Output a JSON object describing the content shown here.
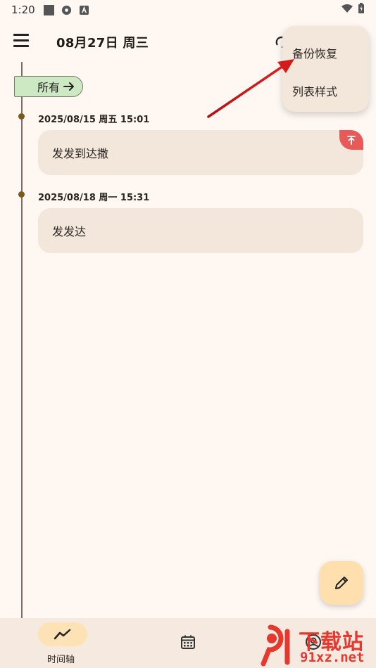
{
  "status_bar": {
    "time": "1:20"
  },
  "app_bar": {
    "title": "08月27日 周三"
  },
  "filter_chip": {
    "label": "所有"
  },
  "entries": [
    {
      "timestamp": "2025/08/15 周五 15:01",
      "text": "发发到达撒",
      "pinned": true
    },
    {
      "timestamp": "2025/08/18 周一 15:31",
      "text": "发发达",
      "pinned": false
    }
  ],
  "popup_menu": {
    "items": [
      {
        "label": "备份恢复"
      },
      {
        "label": "列表样式"
      }
    ]
  },
  "bottom_nav": {
    "items": [
      {
        "label": "时间轴",
        "icon": "timeline-icon",
        "active": true
      },
      {
        "label": "",
        "icon": "calendar-icon",
        "active": false
      },
      {
        "label": "",
        "icon": "profile-icon",
        "active": false
      }
    ]
  },
  "watermark": {
    "text_big": "下载站",
    "text_small": "91xz.net"
  },
  "colors": {
    "background": "#fff7f2",
    "card": "#f3e6db",
    "chip": "#cde9c3",
    "fab": "#ffdfad",
    "pin_badge": "#e85a5a",
    "accent_red": "#e6382e"
  }
}
